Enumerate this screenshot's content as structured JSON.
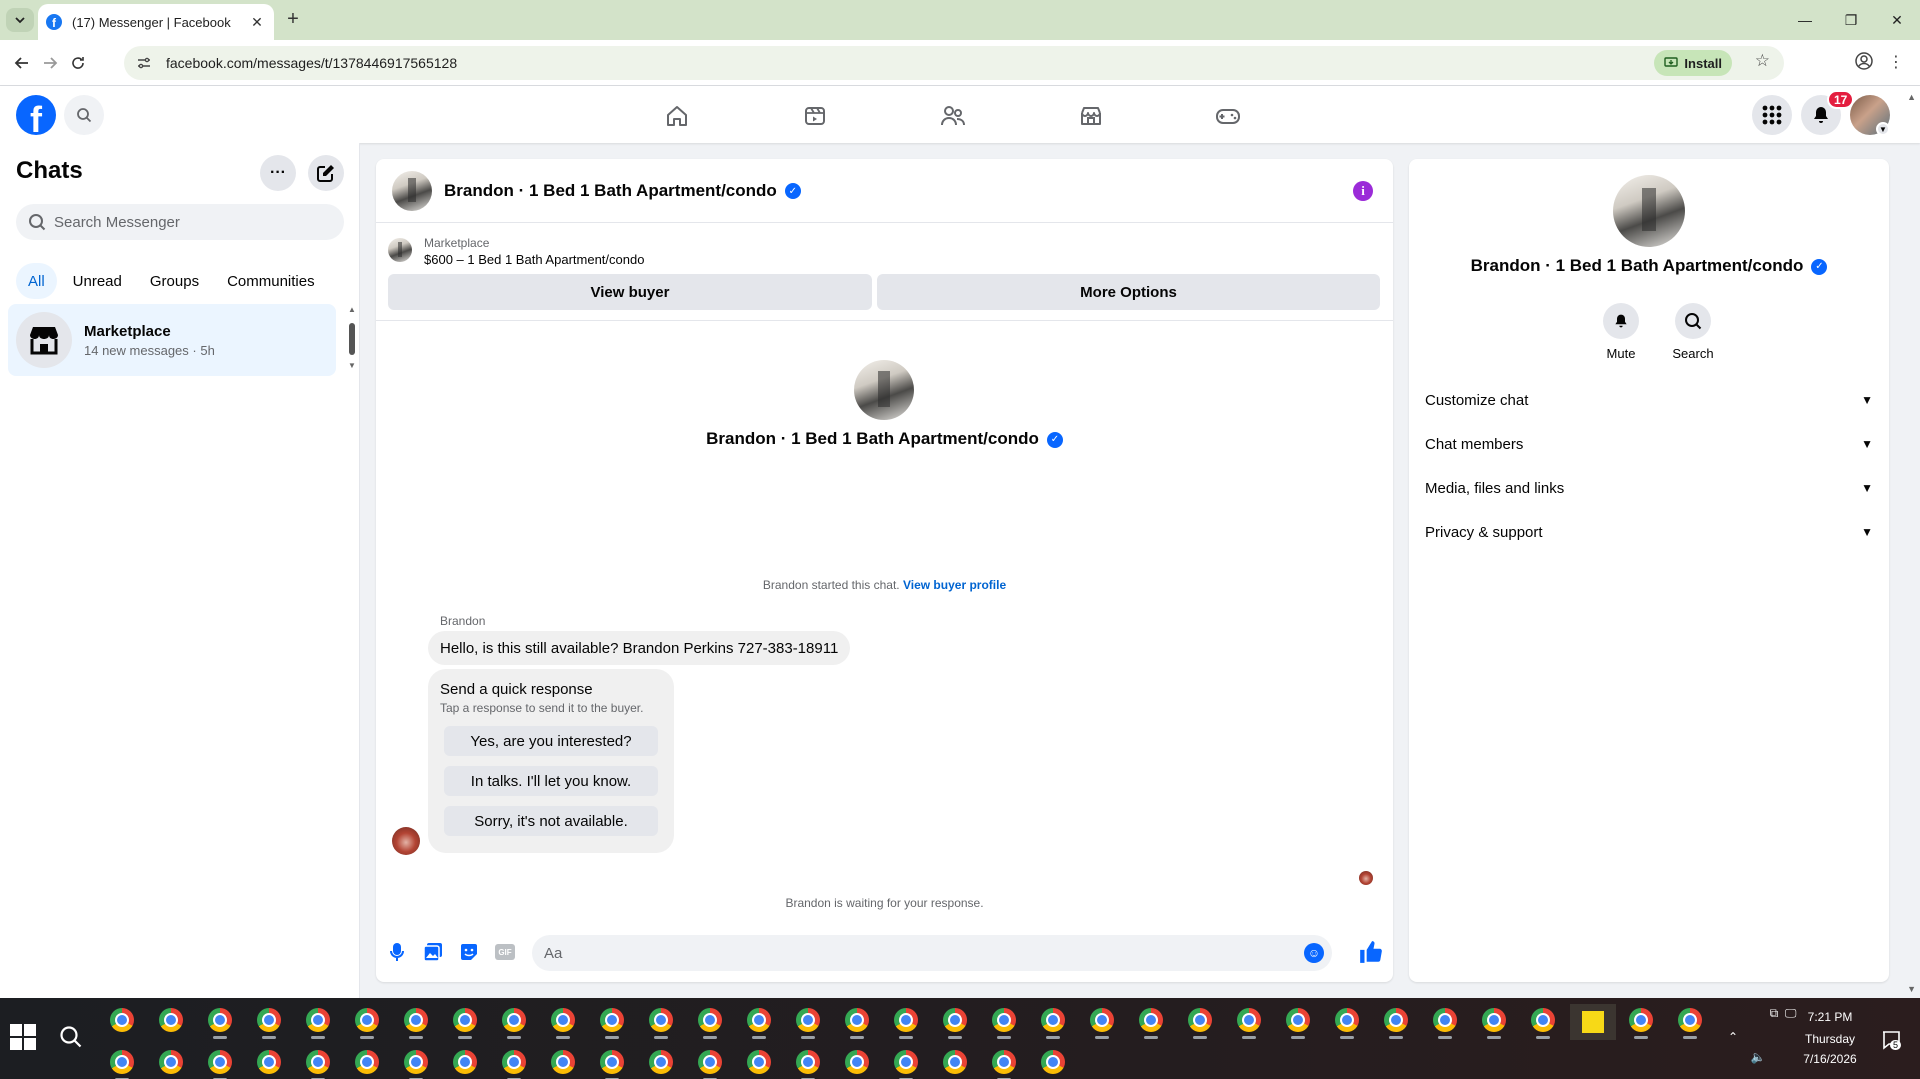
{
  "browser": {
    "tab_title": "(17) Messenger | Facebook",
    "url": "facebook.com/messages/t/1378446917565128",
    "install_label": "Install"
  },
  "fb_nav": {
    "logo_glyph": "f",
    "notification_count": "17"
  },
  "chats": {
    "title": "Chats",
    "more_glyph": "···",
    "search_placeholder": "Search Messenger",
    "filters": [
      "All",
      "Unread",
      "Groups",
      "Communities"
    ],
    "items": [
      {
        "name": "Marketplace",
        "subtitle": "14 new messages · 5h"
      }
    ]
  },
  "conversation": {
    "header_name": "Brandon · 1 Bed 1 Bath Apartment/condo",
    "marketplace_label": "Marketplace",
    "listing_line": "$600 – 1 Bed 1 Bath Apartment/condo",
    "view_buyer_label": "View buyer",
    "more_options_label": "More Options",
    "intro_name": "Brandon · 1 Bed 1 Bath Apartment/condo",
    "started_text": "Brandon started this chat.",
    "view_buyer_profile_label": "View buyer profile",
    "sender_name": "Brandon",
    "message_text": "Hello, is this still available? Brandon Perkins 727-383-18911",
    "quick_response": {
      "title": "Send a quick response",
      "subtitle": "Tap a response to send it to the buyer.",
      "options": [
        "Yes, are you interested?",
        "In talks. I'll let you know.",
        "Sorry, it's not available."
      ]
    },
    "waiting_text": "Brandon is waiting for your response.",
    "input_placeholder": "Aa",
    "gif_label": "GIF"
  },
  "info_panel": {
    "name": "Brandon · 1 Bed 1 Bath Apartment/condo",
    "actions": [
      "Mute",
      "Search"
    ],
    "sections": [
      "Customize chat",
      "Chat members",
      "Media, files and links",
      "Privacy & support"
    ]
  },
  "taskbar": {
    "time": "7:21 PM",
    "day": "Thursday",
    "date": "7/16/2026",
    "notification_count": "5"
  },
  "colors": {
    "facebook_blue": "#0866ff",
    "active_chat_bg": "#ebf5ff",
    "badge_red": "#e41e3f",
    "info_purple": "#9b2bd8"
  }
}
